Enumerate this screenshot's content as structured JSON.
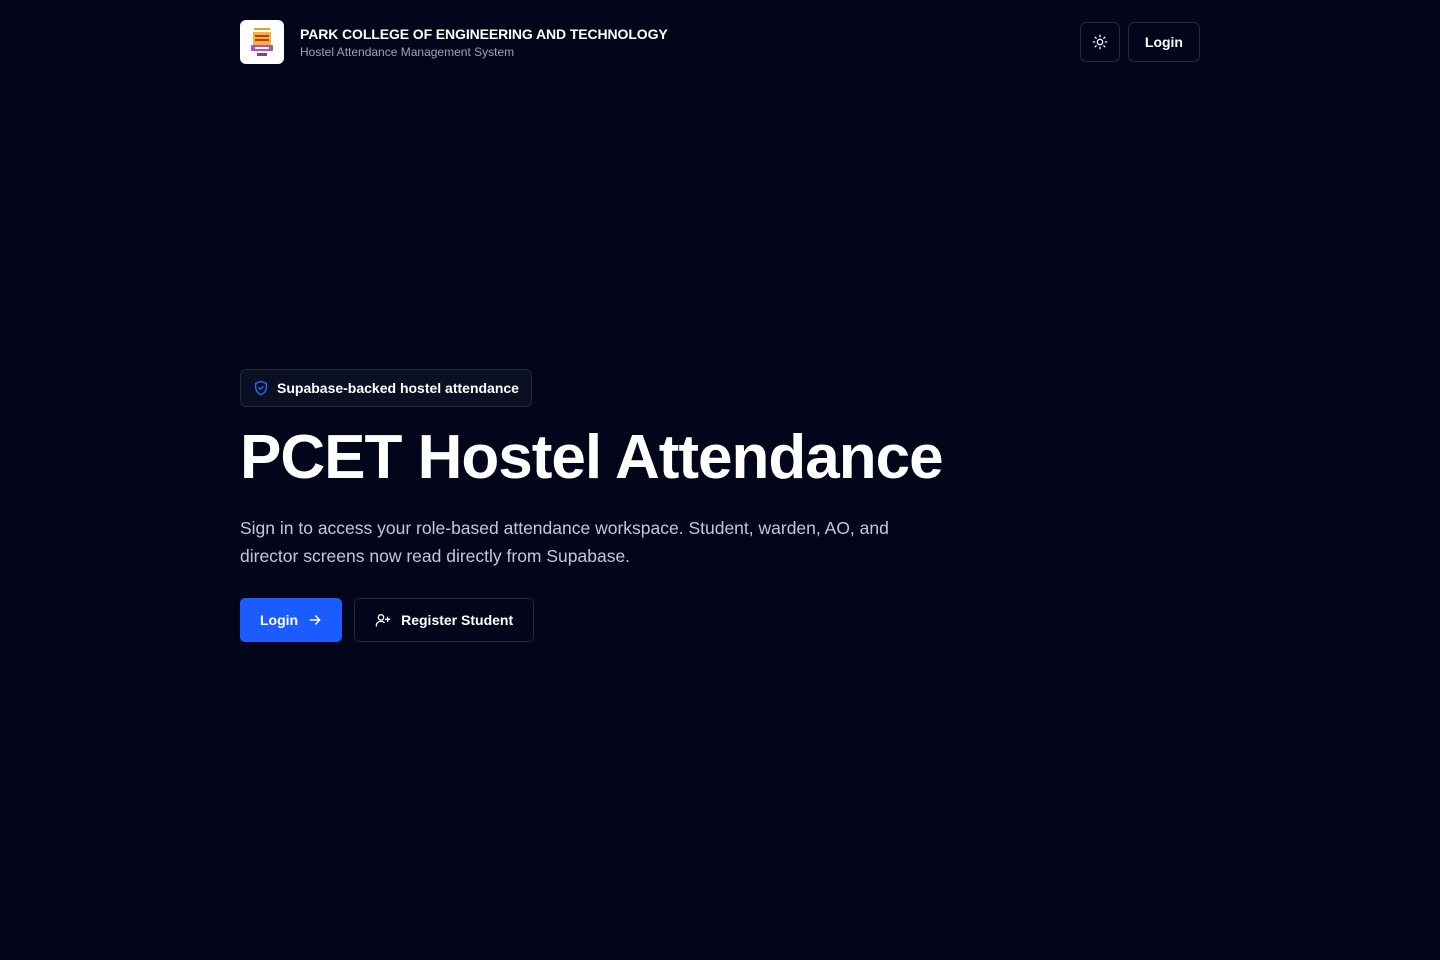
{
  "header": {
    "college_name": "PARK COLLEGE OF ENGINEERING AND TECHNOLOGY",
    "system_name": "Hostel Attendance Management System",
    "logo_icon": "college-crest-logo",
    "theme_toggle_icon": "sun-icon",
    "login_label": "Login"
  },
  "hero": {
    "badge_icon": "shield-check-icon",
    "badge_label": "Supabase-backed hostel attendance",
    "title": "PCET Hostel Attendance",
    "description": "Sign in to access your role-based attendance workspace. Student, warden, AO, and director screens now read directly from Supabase.",
    "login_button_label": "Login",
    "login_button_icon": "arrow-right-icon",
    "register_button_label": "Register Student",
    "register_button_icon": "user-plus-icon"
  },
  "colors": {
    "background": "#03061a",
    "primary": "#1a5cff",
    "border": "#23283a",
    "muted_text": "#9aa3b8",
    "badge_icon": "#2f6bff"
  }
}
